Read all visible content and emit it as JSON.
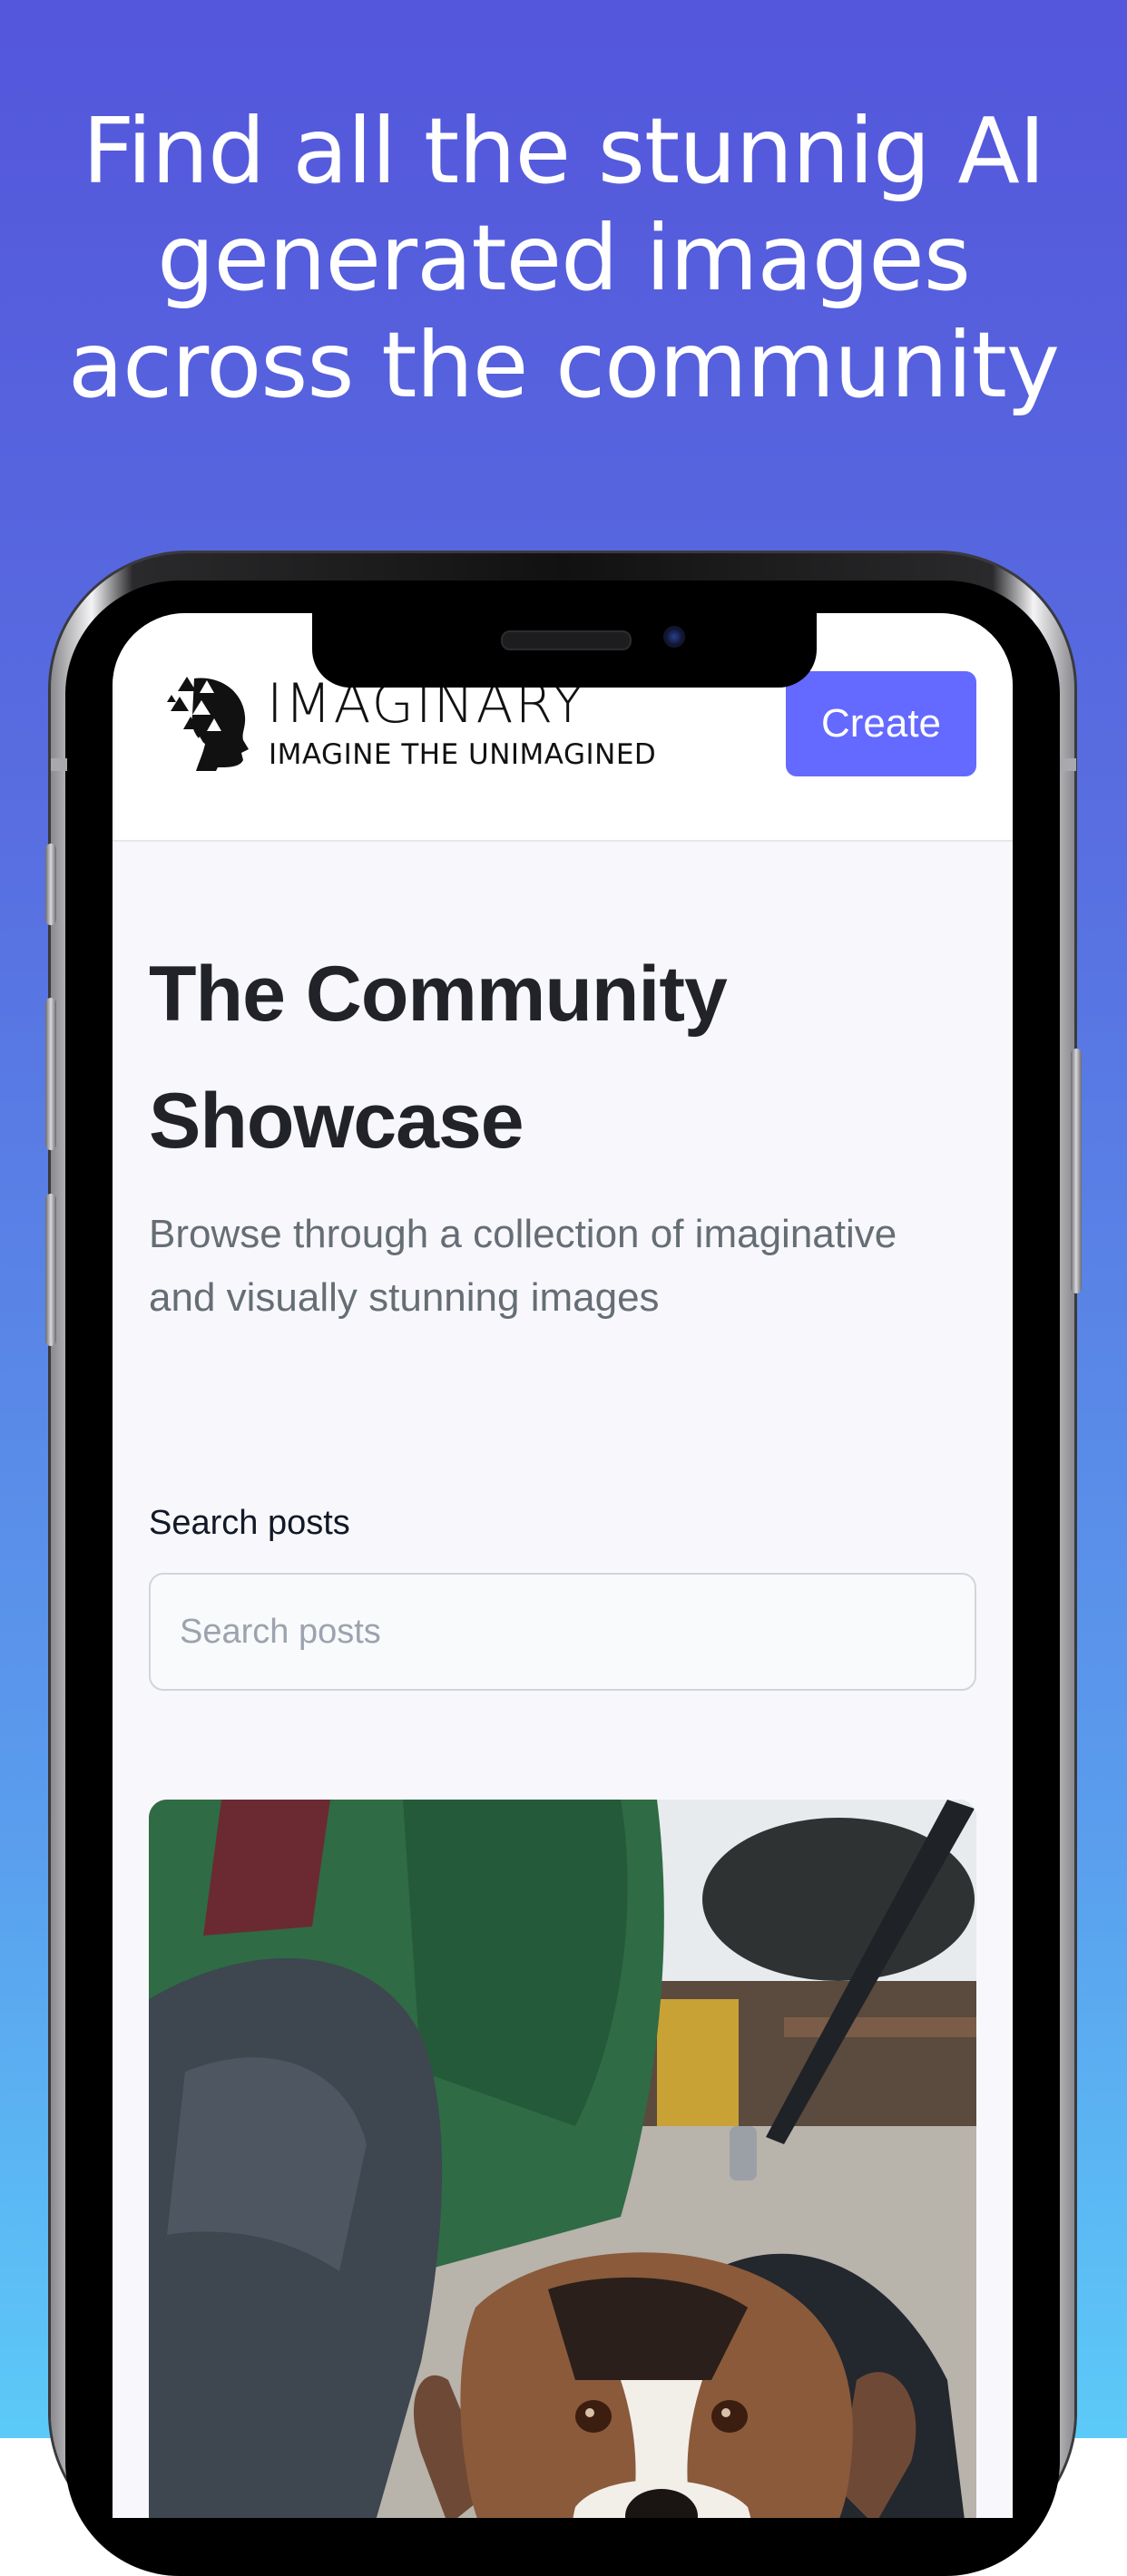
{
  "promo": {
    "headline": "Find all the stunnig AI generated images across the community"
  },
  "header": {
    "brand_name": "IMAGINARY",
    "brand_tagline": "IMAGINE THE UNIMAGINED",
    "create_label": "Create"
  },
  "main": {
    "title": "The Community Showcase",
    "subtitle": "Browse through a collection of imaginative and visually stunning images",
    "search": {
      "label": "Search posts",
      "placeholder": "Search posts",
      "value": ""
    }
  },
  "colors": {
    "background_top": "#5456db",
    "background_bottom": "#5ccaf8",
    "accent": "#6469ff",
    "title_text": "#222328",
    "subtitle_text": "#666e75"
  },
  "icons": {
    "brand_logo": "head-with-triangles-logo"
  }
}
